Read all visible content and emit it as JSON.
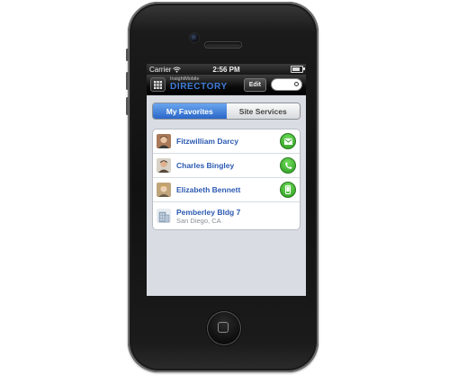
{
  "status_bar": {
    "carrier": "Carrier",
    "time": "2:56 PM"
  },
  "header": {
    "logo_small": "InsightMobile",
    "logo_large": "DIRECTORY",
    "edit_label": "Edit"
  },
  "tabs": [
    {
      "label": "My Favorites",
      "active": true
    },
    {
      "label": "Site Services",
      "active": false
    }
  ],
  "contacts": [
    {
      "name": "Fitzwilliam Darcy",
      "action_icon": "email-icon"
    },
    {
      "name": "Charles Bingley",
      "action_icon": "phone-icon"
    },
    {
      "name": "Elizabeth Bennett",
      "action_icon": "mobile-phone-icon"
    }
  ],
  "location": {
    "name": "Pemberley Bldg 7",
    "city": "San Diego, CA"
  },
  "colors": {
    "accent": "#2a67c9",
    "action_green": "#34a826",
    "link_blue": "#2b59b0"
  }
}
